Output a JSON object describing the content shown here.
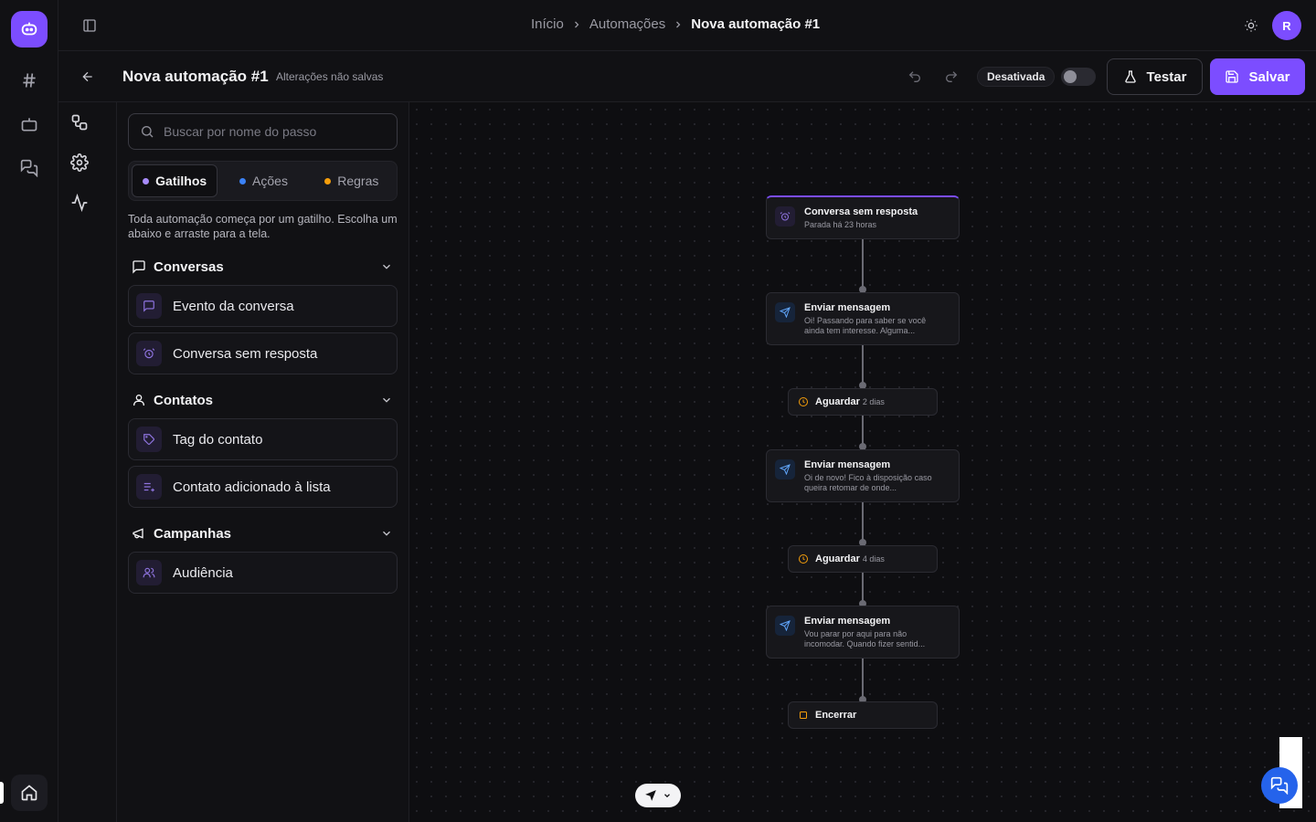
{
  "colors": {
    "accent": "#7c4dff",
    "trigger_dot": "#a78bfa",
    "action_dot": "#3b82f6",
    "rule_dot": "#f59e0b",
    "send_icon": "#60a5fa",
    "wait_icon": "#f59e0b",
    "chat_button": "#2563eb"
  },
  "rail": {
    "logo_icon": "bot-face-icon",
    "items": [
      "hash-icon",
      "bot-icon",
      "chat-icon"
    ],
    "home_icon": "home-icon"
  },
  "breadcrumb": [
    "Início",
    "Automações",
    "Nova automação #1"
  ],
  "user": {
    "avatar_initial": "R"
  },
  "editor": {
    "title": "Nova automação #1",
    "unsaved": "Alterações não salvas",
    "status": "Desativada",
    "active": false,
    "test_label": "Testar",
    "save_label": "Salvar"
  },
  "panel": {
    "search_placeholder": "Buscar por nome do passo",
    "tabs": [
      {
        "label": "Gatilhos",
        "active": true
      },
      {
        "label": "Ações",
        "active": false
      },
      {
        "label": "Regras",
        "active": false
      }
    ],
    "hint": "Toda automação começa por um gatilho. Escolha um abaixo e arraste para a tela.",
    "sections": [
      {
        "title": "Conversas",
        "items": [
          "Evento da conversa",
          "Conversa sem resposta"
        ]
      },
      {
        "title": "Contatos",
        "items": [
          "Tag do contato",
          "Contato adicionado à lista"
        ]
      },
      {
        "title": "Campanhas",
        "items": [
          "Audiência"
        ]
      }
    ]
  },
  "flow": {
    "trigger": {
      "title": "Conversa sem resposta",
      "subtitle": "Parada há 23 horas"
    },
    "send1": {
      "title": "Enviar mensagem",
      "text": "Oi! Passando para saber se você ainda tem interesse. Alguma..."
    },
    "wait1": {
      "title": "Aguardar",
      "detail": "2 dias"
    },
    "send2": {
      "title": "Enviar mensagem",
      "text": "Oi de novo! Fico à disposição caso queira retomar de onde..."
    },
    "wait2": {
      "title": "Aguardar",
      "detail": "4 dias"
    },
    "send3": {
      "title": "Enviar mensagem",
      "text": "Vou parar por aqui para não incomodar. Quando fizer sentid..."
    },
    "end": {
      "title": "Encerrar"
    }
  }
}
